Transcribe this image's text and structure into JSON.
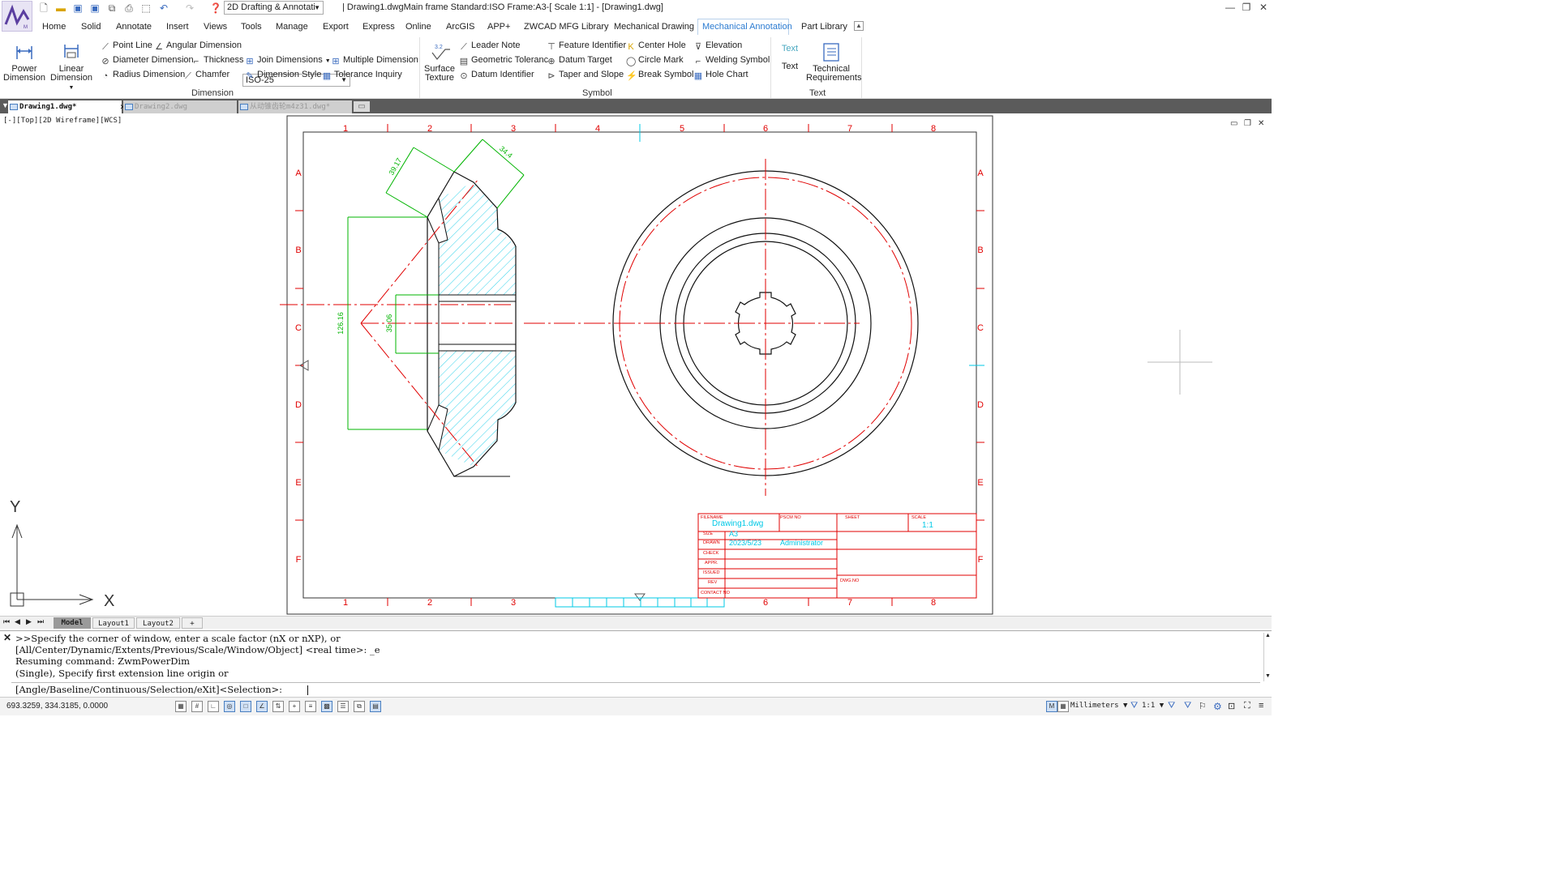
{
  "app": {
    "workspace": "2D Drafting & Annotati",
    "title": "| Drawing1.dwgMain frame  Standard:ISO Frame:A3-[ Scale 1:1] - [Drawing1.dwg]"
  },
  "menu": {
    "tabs": [
      "Home",
      "Solid",
      "Annotate",
      "Insert",
      "Views",
      "Tools",
      "Manage",
      "Export",
      "Express",
      "Online",
      "ArcGIS",
      "APP+",
      "ZWCAD MFG Library",
      "Mechanical Drawing",
      "Mechanical Annotation",
      "Part Library"
    ],
    "active": "Mechanical Annotation"
  },
  "ribbon": {
    "dimension": {
      "label": "Dimension",
      "power": "Power\nDimension",
      "power_l1": "Power",
      "power_l2": "Dimension",
      "linear_l1": "Linear",
      "linear_l2": "Dimension",
      "point_line": "Point Line",
      "angular": "Angular Dimension",
      "diameter": "Diameter Dimension",
      "thickness": "Thickness",
      "radius": "Radius Dimension",
      "chamfer": "Chamfer",
      "style_combo": "ISO-25",
      "join": "Join Dimensions",
      "multiple": "Multiple Dimension",
      "dim_style": "Dimension Style",
      "tolerance": "Tolerance Inquiry"
    },
    "symbol": {
      "label": "Symbol",
      "surface_l1": "Surface",
      "surface_l2": "Texture",
      "surface_icon_text": "3.2",
      "leader": "Leader Note",
      "geometric": "Geometric Toleranc",
      "datum_id": "Datum Identifier",
      "feature": "Feature Identifier",
      "datum_target": "Datum Target",
      "taper": "Taper and Slope",
      "center_hole": "Center Hole",
      "circle_mark": "Circle Mark",
      "break": "Break Symbol",
      "elevation": "Elevation",
      "welding": "Welding Symbol",
      "hole_chart": "Hole Chart"
    },
    "text": {
      "label": "Text",
      "text_icon": "Text",
      "text": "Text",
      "tech_l1": "Technical",
      "tech_l2": "Requirements"
    }
  },
  "doc_tabs": [
    "Drawing1.dwg*",
    "Drawing2.dwg",
    "从动锥齿轮m4z31.dwg*"
  ],
  "viewport_label": "[-][Top][2D Wireframe][WCS]",
  "drawing": {
    "dims": {
      "d1": "39.17",
      "d2": "34.4",
      "d3": "126.16",
      "d4": "35.06"
    },
    "border_cols": [
      "1",
      "2",
      "3",
      "4",
      "5",
      "6",
      "7",
      "8"
    ],
    "border_cols_bottom": [
      "1",
      "2",
      "3",
      "6",
      "7",
      "8"
    ],
    "border_rows": [
      "A",
      "B",
      "C",
      "D",
      "E",
      "F"
    ],
    "title_block": {
      "filename_label": "FILENAME",
      "filename": "Drawing1.dwg",
      "pscm_label": "PSCM NO",
      "sheet_label": "SHEET",
      "scale_label": "SCALE",
      "scale": "1:1",
      "size_label": "SIZE",
      "size": "A3",
      "drawn_label": "DRAWN",
      "drawn_date": "2023/5/23",
      "drawn_by": "Administrator",
      "check_label": "CHECK",
      "appr_label": "APPR.",
      "issued_label": "ISSUED",
      "rev_label": "REV",
      "contact_label": "CONTACT NO",
      "dwgno_label": "DWG.NO"
    },
    "ucs": {
      "x": "X",
      "y": "Y"
    }
  },
  "layout_tabs": [
    "Model",
    "Layout1",
    "Layout2",
    "+"
  ],
  "command": {
    "lines": [
      ">>Specify the corner of window, enter a scale factor (nX or nXP), or",
      "[All/Center/Dynamic/Extents/Previous/Scale/Window/Object] <real time>: _e",
      "Resuming command: ZwmPowerDim",
      "(Single), Specify first extension line origin or"
    ],
    "prompt": "[Angle/Baseline/Continuous/Selection/eXit]<Selection>:"
  },
  "status": {
    "coords": "693.3259,  334.3185,  0.0000",
    "units": "Millimeters",
    "scale": "1:1"
  },
  "colors": {
    "red": "#e00000",
    "green": "#00b400",
    "cyan": "#00c8e6",
    "accent": "#2b7bd1"
  }
}
